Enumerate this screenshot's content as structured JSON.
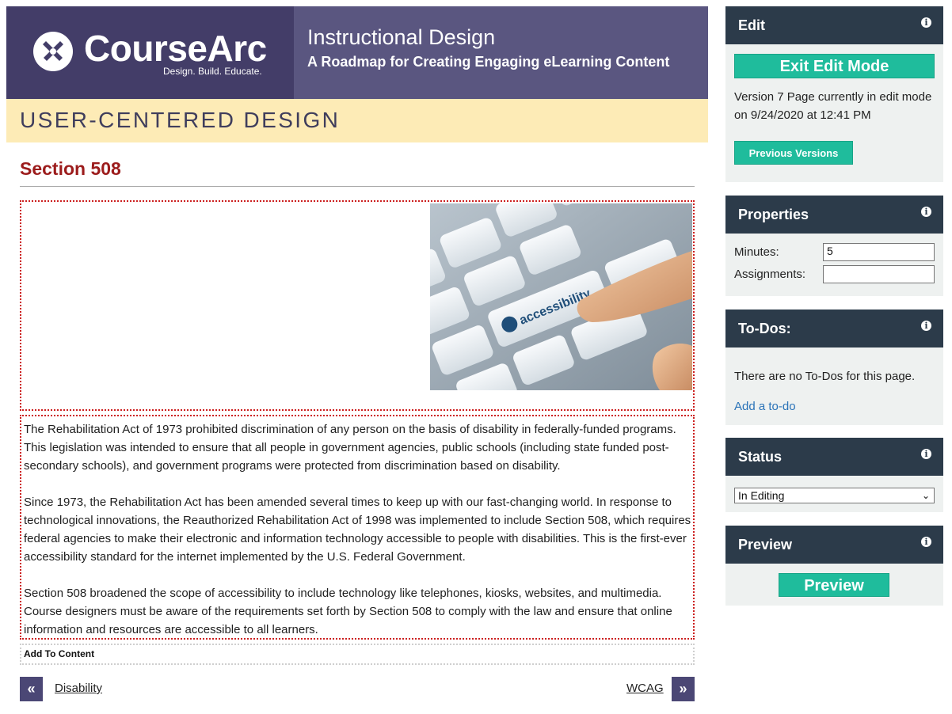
{
  "banner": {
    "logo_word": "CourseArc",
    "logo_tagline": "Design. Build. Educate.",
    "course_title": "Instructional Design",
    "course_subtitle": "A Roadmap for Creating Engaging eLearning Content"
  },
  "unit": {
    "title": "USER-CENTERED DESIGN"
  },
  "page": {
    "heading": "Section 508",
    "image_key_text": "accessibility",
    "paragraphs": [
      "The Rehabilitation Act of 1973 prohibited discrimination of any person on the basis of disability in federally-funded programs. This legislation was intended to ensure that all people in government agencies, public schools (including state funded post-secondary schools), and government programs were protected from discrimination based on disability.",
      "Since 1973, the Rehabilitation Act has been amended several times to keep up with our fast-changing world. In response to technological innovations, the Reauthorized Rehabilitation Act of 1998 was implemented to include Section 508, which requires federal agencies to make their electronic and information technology accessible to people with disabilities. This is the first-ever accessibility standard for the internet implemented by the U.S. Federal Government.",
      "Section 508 broadened the scope of accessibility to include technology like telephones, kiosks, websites, and multimedia. Course designers must be aware of the requirements set forth by Section 508 to comply with the law and ensure that online information and resources are accessible to all learners."
    ],
    "add_to_content": "Add To Content"
  },
  "navigation": {
    "prev_icon": "«",
    "prev_label": "Disability",
    "next_icon": "»",
    "next_label": "WCAG"
  },
  "panels": {
    "edit": {
      "title": "Edit",
      "info_icon": "i",
      "exit_button": "Exit Edit Mode",
      "version_text": "Version 7   Page currently in edit mode on 9/24/2020 at 12:41 PM",
      "previous_versions_button": "Previous Versions"
    },
    "properties": {
      "title": "Properties",
      "info_icon": "i",
      "minutes_label": "Minutes:",
      "minutes_value": "5",
      "assignments_label": "Assignments:",
      "assignments_value": ""
    },
    "todos": {
      "title": "To-Dos:",
      "info_icon": "i",
      "empty_text": "There are no To-Dos for this page.",
      "add_link": "Add a to-do"
    },
    "status": {
      "title": "Status",
      "info_icon": "i",
      "selected": "In Editing",
      "chevron": "⌄"
    },
    "preview": {
      "title": "Preview",
      "info_icon": "i",
      "button": "Preview"
    }
  },
  "colors": {
    "banner_dark": "#433d68",
    "banner": "#5a5680",
    "unit_strip": "#fdebb6",
    "heading_red": "#9c1c1c",
    "panel_header": "#2c3b4a",
    "panel_body": "#eef1f0",
    "accent_green": "#1fbc9c",
    "link_blue": "#2a73b8",
    "nav_button": "#4b4775"
  }
}
